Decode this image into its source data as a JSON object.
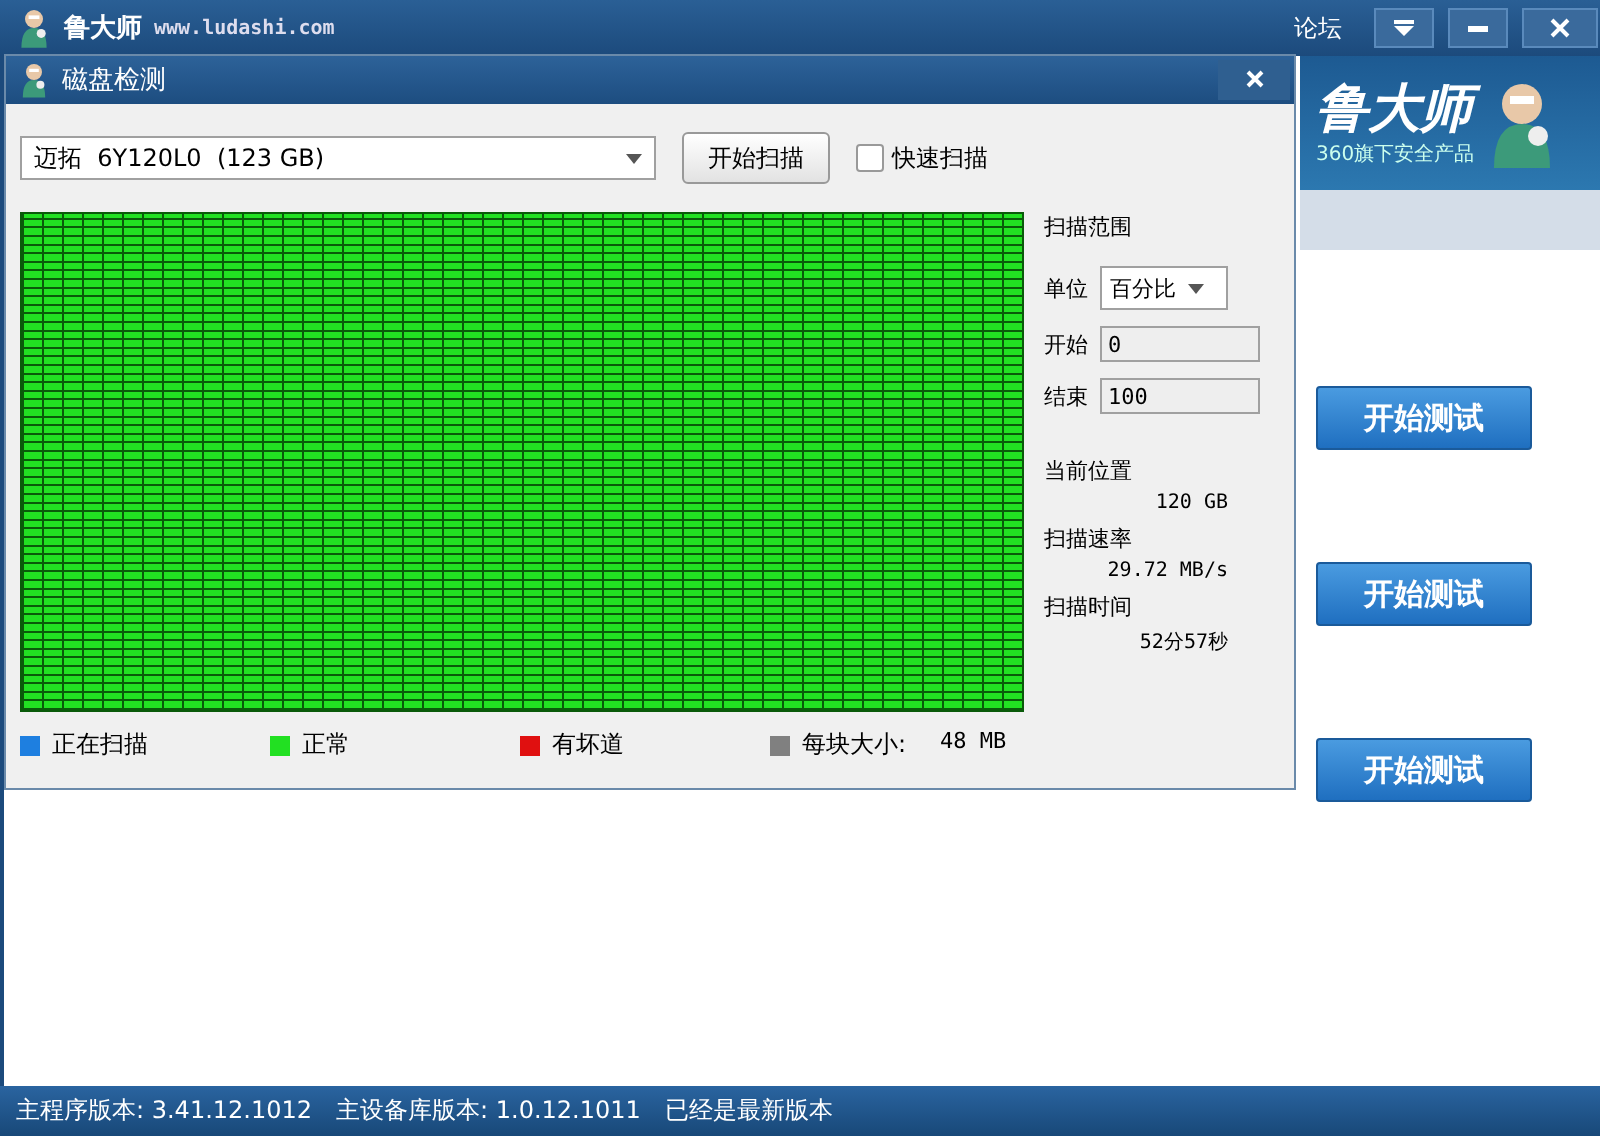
{
  "main_window": {
    "title": "鲁大师",
    "url": "www.ludashi.com",
    "forum_link": "论坛",
    "logo_text": "鲁大师",
    "logo_slogan": "360旗下安全产品",
    "test_buttons": [
      "开始测试",
      "开始测试",
      "开始测试"
    ]
  },
  "dialog": {
    "title": "磁盘检测",
    "drive_select": {
      "value": "迈拓  6Y120L0  (123 GB)"
    },
    "start_button": "开始扫描",
    "quick_scan": {
      "label": "快速扫描",
      "checked": false
    },
    "range": {
      "heading": "扫描范围",
      "unit_label": "单位",
      "unit_value": "百分比",
      "start_label": "开始",
      "start_value": "0",
      "end_label": "结束",
      "end_value": "100"
    },
    "stats": [
      {
        "label": "当前位置",
        "value": "120 GB"
      },
      {
        "label": "扫描速率",
        "value": "29.72 MB/s"
      },
      {
        "label": "扫描时间",
        "value": "52分57秒"
      }
    ],
    "legend": [
      {
        "label": "正在扫描",
        "color": "#1e7fe0"
      },
      {
        "label": "正常",
        "color": "#22e022"
      },
      {
        "label": "有坏道",
        "color": "#e01010"
      },
      {
        "label": "每块大小:",
        "color": "#808080"
      }
    ],
    "block_size": "48 MB"
  },
  "status_bar": {
    "program_version": "主程序版本: 3.41.12.1012",
    "db_version": "主设备库版本: 1.0.12.1011",
    "update_status": "已经是最新版本"
  }
}
